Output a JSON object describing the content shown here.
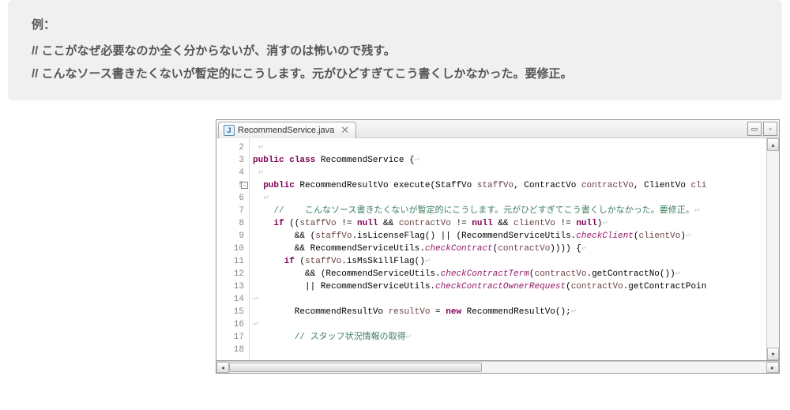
{
  "example": {
    "label": "例：",
    "line1": "  // ここがなぜ必要なのか全く分からないが、消すのは怖いので残す。",
    "line2": "  // こんなソース書きたくないが暫定的にこうします。元がひどすぎてこう書くしかなかった。要修正。"
  },
  "tab": {
    "filename": "RecommendService.java",
    "icon_letter": "J"
  },
  "gutter": {
    "lines": [
      "2",
      "3",
      "4",
      "5",
      "6",
      "7",
      "8",
      "9",
      "10",
      "11",
      "12",
      "13",
      "14",
      "15",
      "16",
      "17",
      "18"
    ]
  },
  "code": {
    "l3_kw1": "public",
    "l3_kw2": "class",
    "l3_rest": " RecommendService {",
    "l5_kw1": "  public",
    "l5_text1": " RecommendResultVo execute(StaffVo ",
    "l5_p1": "staffVo",
    "l5_text2": ", ContractVo ",
    "l5_p2": "contractVo",
    "l5_text3": ", ClientVo ",
    "l5_p3": "cli",
    "l7_comment": "    //    こんなソース書きたくないが暫定的にこうします。元がひどすぎてこう書くしかなかった。要修正。",
    "l8_kw": "    if",
    "l8_text1": " ((",
    "l8_v1": "staffVo",
    "l8_text2": " != ",
    "l8_kw2": "null",
    "l8_text3": " && ",
    "l8_v2": "contractVo",
    "l8_text4": " != ",
    "l8_kw3": "null",
    "l8_text5": " && ",
    "l8_v3": "clientVo",
    "l8_text6": " != ",
    "l8_kw4": "null",
    "l8_text7": ")",
    "l9_text1": "        && (",
    "l9_v1": "staffVo",
    "l9_text2": ".isLicenseFlag() || (RecommendServiceUtils.",
    "l9_m1": "checkClient",
    "l9_text3": "(",
    "l9_v2": "clientVo",
    "l9_text4": ")",
    "l10_text1": "        && RecommendServiceUtils.",
    "l10_m1": "checkContract",
    "l10_text2": "(",
    "l10_v1": "contractVo",
    "l10_text3": ")))) {",
    "l11_kw": "      if",
    "l11_text1": " (",
    "l11_v1": "staffVo",
    "l11_text2": ".isMsSkillFlag()",
    "l12_text1": "          && (RecommendServiceUtils.",
    "l12_m1": "checkContractTerm",
    "l12_text2": "(",
    "l12_v1": "contractVo",
    "l12_text3": ".getContractNo())",
    "l13_text1": "          || RecommendServiceUtils.",
    "l13_m1": "checkContractOwnerRequest",
    "l13_text2": "(",
    "l13_v1": "contractVo",
    "l13_text3": ".getContractPoin",
    "l15_text1": "        RecommendResultVo ",
    "l15_v1": "resultVo",
    "l15_text2": " = ",
    "l15_kw": "new",
    "l15_text3": " RecommendResultVo();",
    "l17_comment": "        // スタッフ状況情報の取得",
    "pilcrow": "↩",
    "minimize": "▭",
    "maximize": "▫"
  }
}
